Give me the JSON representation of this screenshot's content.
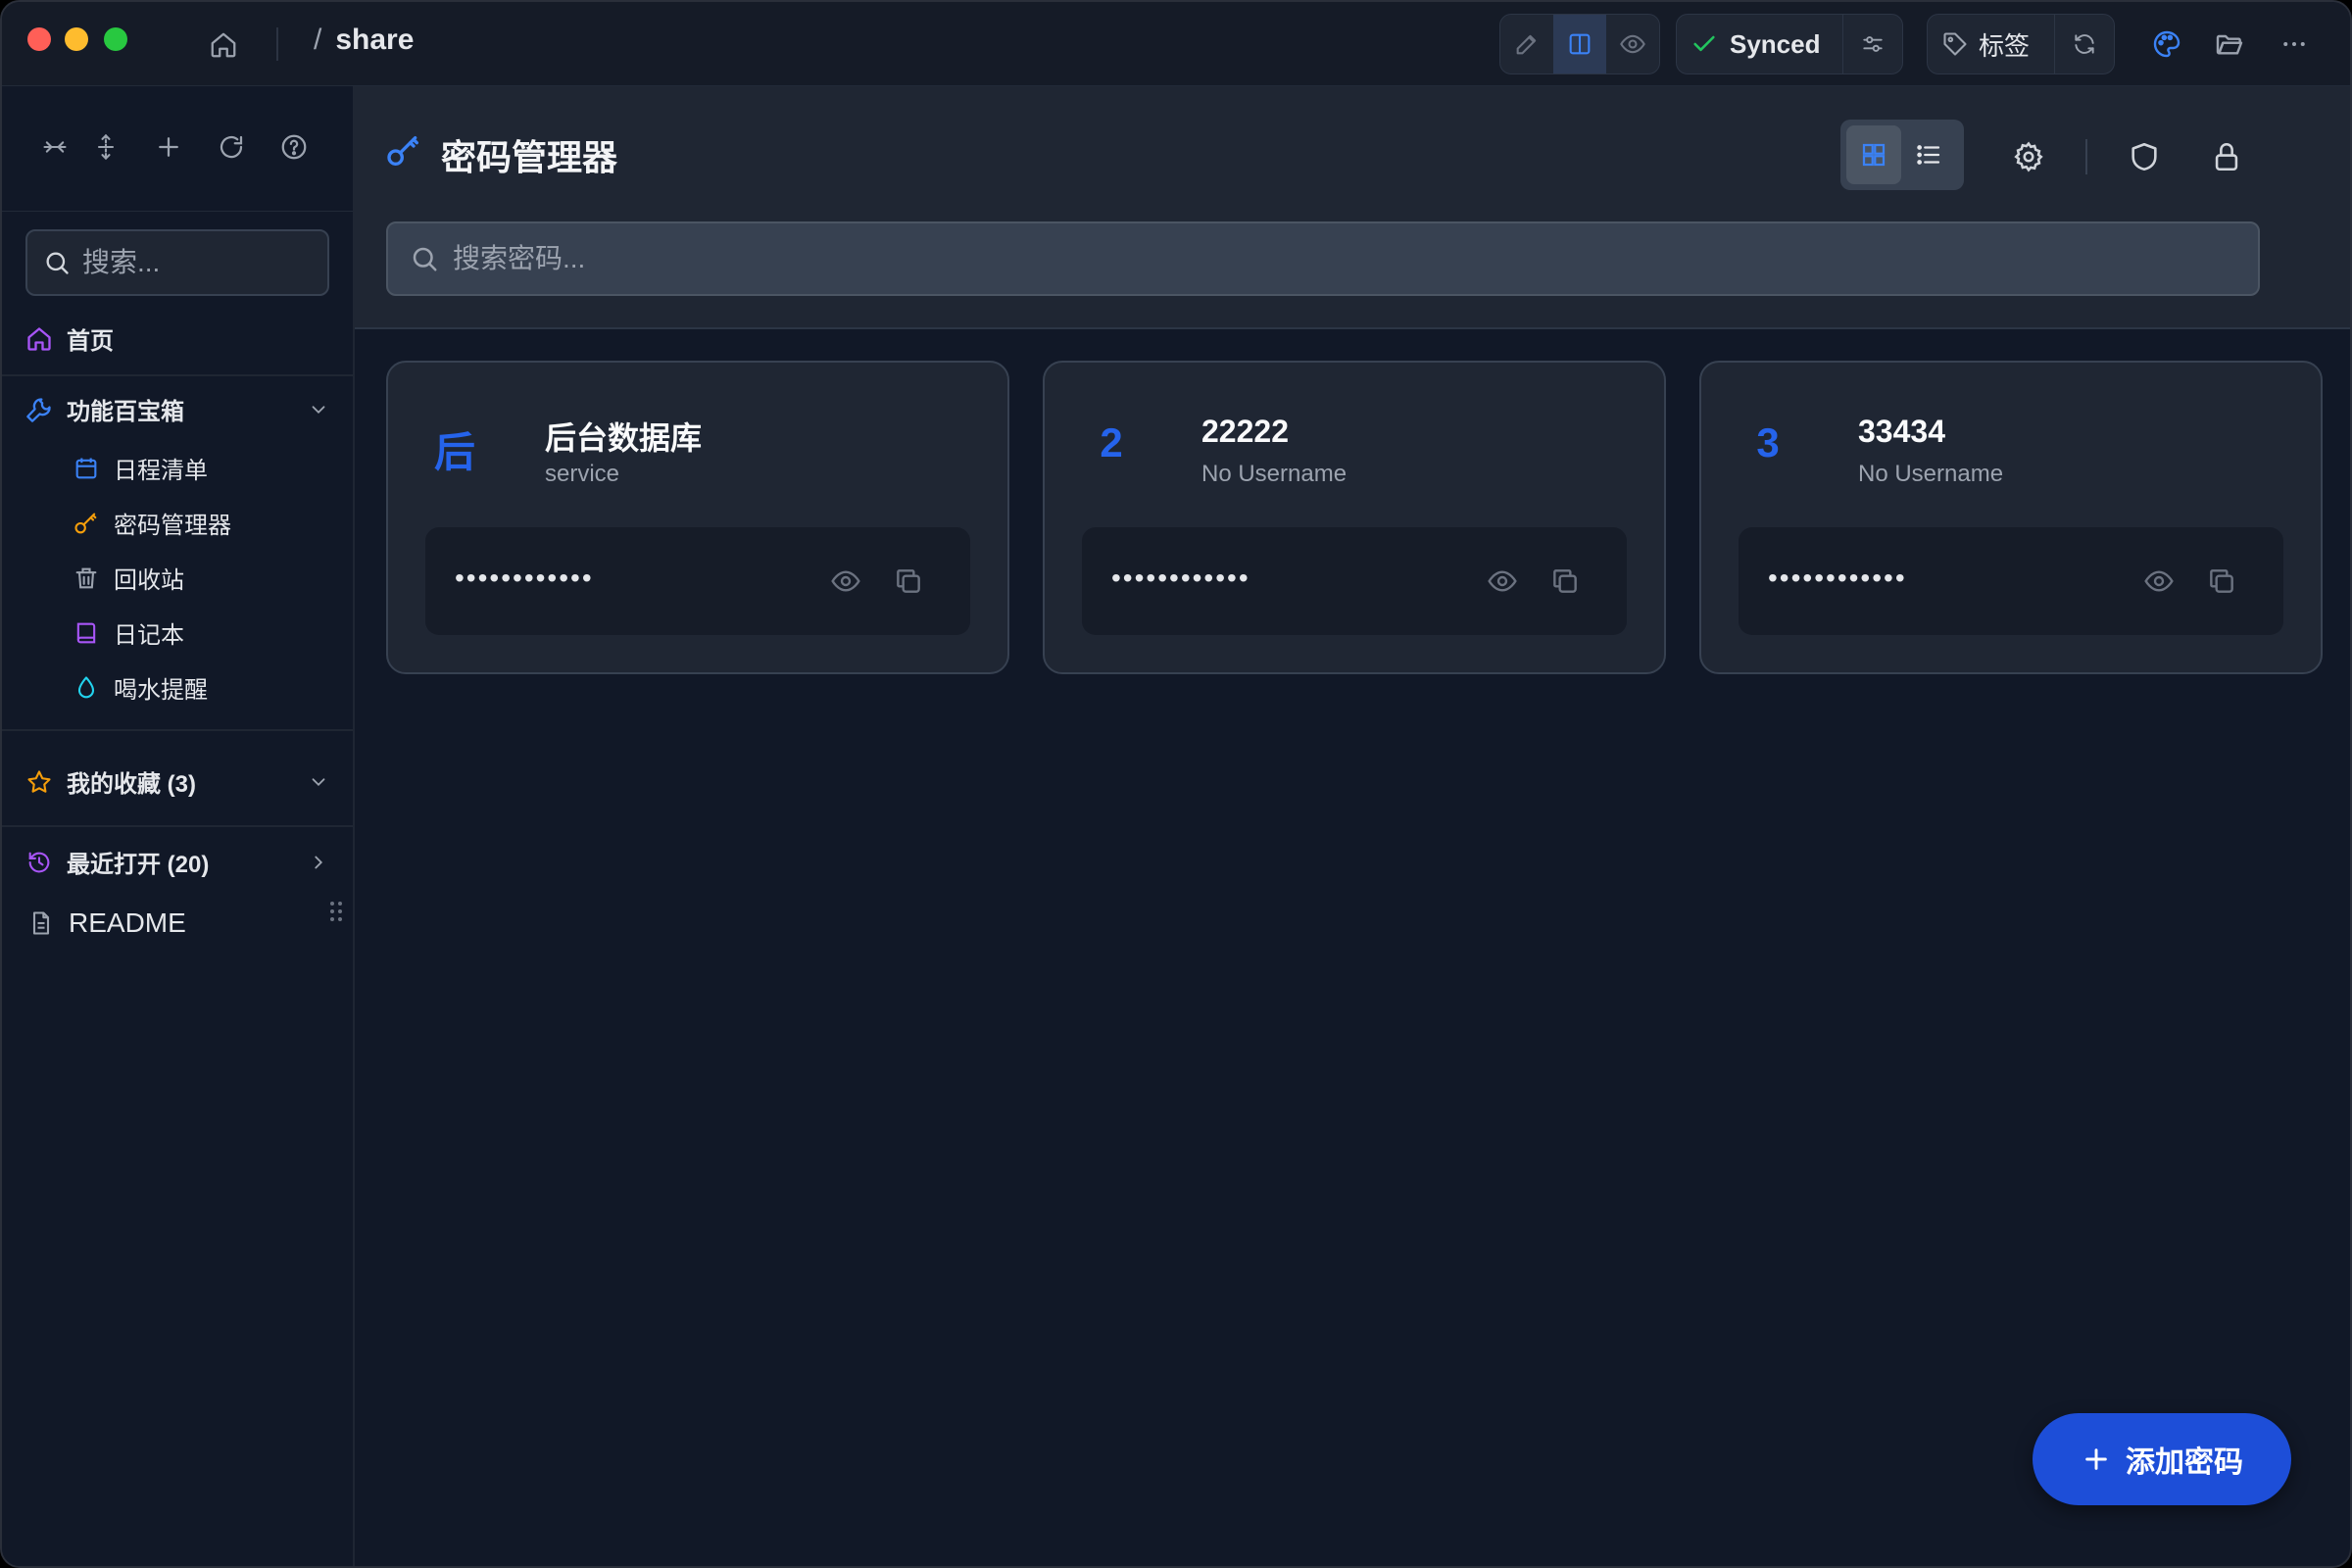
{
  "titlebar": {
    "breadcrumb_slash": "/",
    "breadcrumb_name": "share",
    "sync_status": "Synced",
    "tags_label": "标签"
  },
  "sidebar": {
    "search_placeholder": "搜索...",
    "home_label": "首页",
    "toolbox": {
      "label": "功能百宝箱",
      "items": [
        {
          "label": "日程清单",
          "icon": "calendar-icon"
        },
        {
          "label": "密码管理器",
          "icon": "key-icon"
        },
        {
          "label": "回收站",
          "icon": "trash-icon"
        },
        {
          "label": "日记本",
          "icon": "book-icon"
        },
        {
          "label": "喝水提醒",
          "icon": "water-drop-icon"
        }
      ]
    },
    "favorites_label": "我的收藏 (3)",
    "recent_label": "最近打开 (20)",
    "readme_label": "README"
  },
  "main": {
    "title": "密码管理器",
    "search_placeholder": "搜索密码...",
    "cards": [
      {
        "initial": "后",
        "name": "后台数据库",
        "username": "service",
        "password_mask": "••••••••••••"
      },
      {
        "initial": "2",
        "name": "22222",
        "username": "No Username",
        "password_mask": "••••••••••••"
      },
      {
        "initial": "3",
        "name": "33434",
        "username": "No Username",
        "password_mask": "••••••••••••"
      }
    ],
    "add_button_label": "添加密码"
  },
  "colors": {
    "accent": "#2563eb",
    "background": "#111827",
    "panel": "#1f2633",
    "synced_check": "#22c55e"
  }
}
